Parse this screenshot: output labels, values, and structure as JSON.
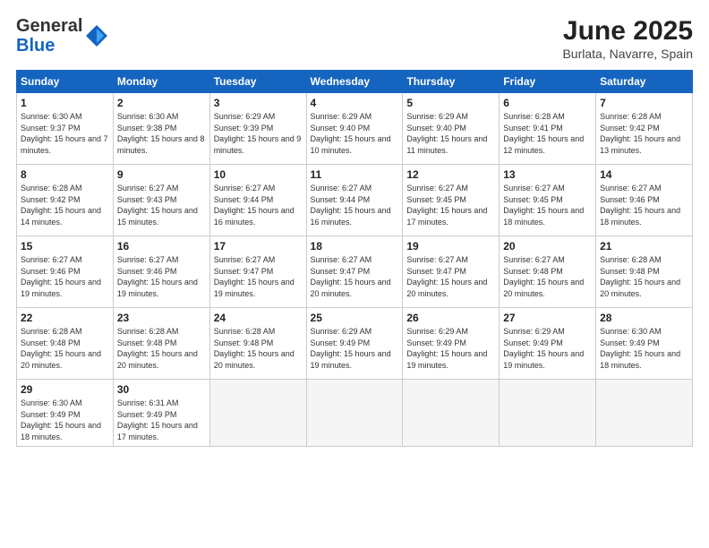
{
  "header": {
    "logo_general": "General",
    "logo_blue": "Blue",
    "month_title": "June 2025",
    "location": "Burlata, Navarre, Spain"
  },
  "weekdays": [
    "Sunday",
    "Monday",
    "Tuesday",
    "Wednesday",
    "Thursday",
    "Friday",
    "Saturday"
  ],
  "weeks": [
    [
      {
        "day": "1",
        "sunrise": "Sunrise: 6:30 AM",
        "sunset": "Sunset: 9:37 PM",
        "daylight": "Daylight: 15 hours and 7 minutes."
      },
      {
        "day": "2",
        "sunrise": "Sunrise: 6:30 AM",
        "sunset": "Sunset: 9:38 PM",
        "daylight": "Daylight: 15 hours and 8 minutes."
      },
      {
        "day": "3",
        "sunrise": "Sunrise: 6:29 AM",
        "sunset": "Sunset: 9:39 PM",
        "daylight": "Daylight: 15 hours and 9 minutes."
      },
      {
        "day": "4",
        "sunrise": "Sunrise: 6:29 AM",
        "sunset": "Sunset: 9:40 PM",
        "daylight": "Daylight: 15 hours and 10 minutes."
      },
      {
        "day": "5",
        "sunrise": "Sunrise: 6:29 AM",
        "sunset": "Sunset: 9:40 PM",
        "daylight": "Daylight: 15 hours and 11 minutes."
      },
      {
        "day": "6",
        "sunrise": "Sunrise: 6:28 AM",
        "sunset": "Sunset: 9:41 PM",
        "daylight": "Daylight: 15 hours and 12 minutes."
      },
      {
        "day": "7",
        "sunrise": "Sunrise: 6:28 AM",
        "sunset": "Sunset: 9:42 PM",
        "daylight": "Daylight: 15 hours and 13 minutes."
      }
    ],
    [
      {
        "day": "8",
        "sunrise": "Sunrise: 6:28 AM",
        "sunset": "Sunset: 9:42 PM",
        "daylight": "Daylight: 15 hours and 14 minutes."
      },
      {
        "day": "9",
        "sunrise": "Sunrise: 6:27 AM",
        "sunset": "Sunset: 9:43 PM",
        "daylight": "Daylight: 15 hours and 15 minutes."
      },
      {
        "day": "10",
        "sunrise": "Sunrise: 6:27 AM",
        "sunset": "Sunset: 9:44 PM",
        "daylight": "Daylight: 15 hours and 16 minutes."
      },
      {
        "day": "11",
        "sunrise": "Sunrise: 6:27 AM",
        "sunset": "Sunset: 9:44 PM",
        "daylight": "Daylight: 15 hours and 16 minutes."
      },
      {
        "day": "12",
        "sunrise": "Sunrise: 6:27 AM",
        "sunset": "Sunset: 9:45 PM",
        "daylight": "Daylight: 15 hours and 17 minutes."
      },
      {
        "day": "13",
        "sunrise": "Sunrise: 6:27 AM",
        "sunset": "Sunset: 9:45 PM",
        "daylight": "Daylight: 15 hours and 18 minutes."
      },
      {
        "day": "14",
        "sunrise": "Sunrise: 6:27 AM",
        "sunset": "Sunset: 9:46 PM",
        "daylight": "Daylight: 15 hours and 18 minutes."
      }
    ],
    [
      {
        "day": "15",
        "sunrise": "Sunrise: 6:27 AM",
        "sunset": "Sunset: 9:46 PM",
        "daylight": "Daylight: 15 hours and 19 minutes."
      },
      {
        "day": "16",
        "sunrise": "Sunrise: 6:27 AM",
        "sunset": "Sunset: 9:46 PM",
        "daylight": "Daylight: 15 hours and 19 minutes."
      },
      {
        "day": "17",
        "sunrise": "Sunrise: 6:27 AM",
        "sunset": "Sunset: 9:47 PM",
        "daylight": "Daylight: 15 hours and 19 minutes."
      },
      {
        "day": "18",
        "sunrise": "Sunrise: 6:27 AM",
        "sunset": "Sunset: 9:47 PM",
        "daylight": "Daylight: 15 hours and 20 minutes."
      },
      {
        "day": "19",
        "sunrise": "Sunrise: 6:27 AM",
        "sunset": "Sunset: 9:47 PM",
        "daylight": "Daylight: 15 hours and 20 minutes."
      },
      {
        "day": "20",
        "sunrise": "Sunrise: 6:27 AM",
        "sunset": "Sunset: 9:48 PM",
        "daylight": "Daylight: 15 hours and 20 minutes."
      },
      {
        "day": "21",
        "sunrise": "Sunrise: 6:28 AM",
        "sunset": "Sunset: 9:48 PM",
        "daylight": "Daylight: 15 hours and 20 minutes."
      }
    ],
    [
      {
        "day": "22",
        "sunrise": "Sunrise: 6:28 AM",
        "sunset": "Sunset: 9:48 PM",
        "daylight": "Daylight: 15 hours and 20 minutes."
      },
      {
        "day": "23",
        "sunrise": "Sunrise: 6:28 AM",
        "sunset": "Sunset: 9:48 PM",
        "daylight": "Daylight: 15 hours and 20 minutes."
      },
      {
        "day": "24",
        "sunrise": "Sunrise: 6:28 AM",
        "sunset": "Sunset: 9:48 PM",
        "daylight": "Daylight: 15 hours and 20 minutes."
      },
      {
        "day": "25",
        "sunrise": "Sunrise: 6:29 AM",
        "sunset": "Sunset: 9:49 PM",
        "daylight": "Daylight: 15 hours and 19 minutes."
      },
      {
        "day": "26",
        "sunrise": "Sunrise: 6:29 AM",
        "sunset": "Sunset: 9:49 PM",
        "daylight": "Daylight: 15 hours and 19 minutes."
      },
      {
        "day": "27",
        "sunrise": "Sunrise: 6:29 AM",
        "sunset": "Sunset: 9:49 PM",
        "daylight": "Daylight: 15 hours and 19 minutes."
      },
      {
        "day": "28",
        "sunrise": "Sunrise: 6:30 AM",
        "sunset": "Sunset: 9:49 PM",
        "daylight": "Daylight: 15 hours and 18 minutes."
      }
    ],
    [
      {
        "day": "29",
        "sunrise": "Sunrise: 6:30 AM",
        "sunset": "Sunset: 9:49 PM",
        "daylight": "Daylight: 15 hours and 18 minutes."
      },
      {
        "day": "30",
        "sunrise": "Sunrise: 6:31 AM",
        "sunset": "Sunset: 9:49 PM",
        "daylight": "Daylight: 15 hours and 17 minutes."
      },
      null,
      null,
      null,
      null,
      null
    ]
  ]
}
